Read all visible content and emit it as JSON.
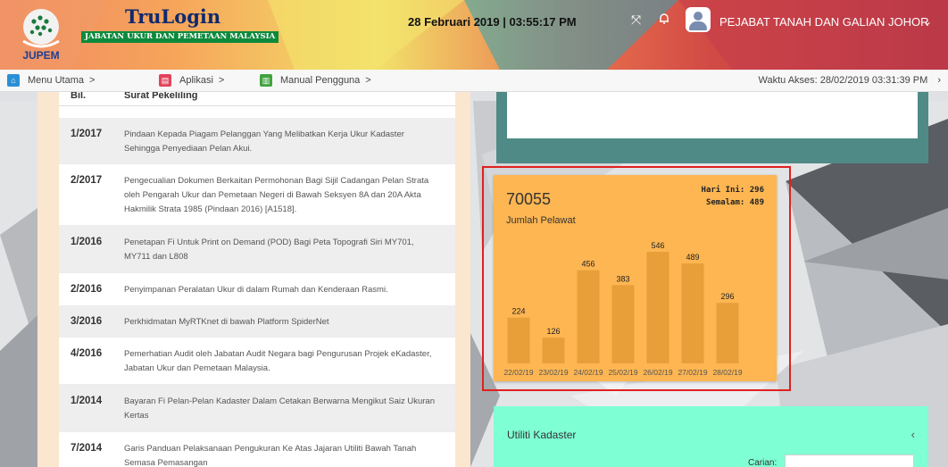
{
  "header": {
    "app_title": "TruLogin",
    "app_subtitle": "JABATAN UKUR DAN PEMETAAN MALAYSIA",
    "logo_text": "JUPEM",
    "datetime": "28 Februari 2019 | 03:55:17 PM",
    "office_name": "PEJABAT TANAH DAN GALIAN JOHOR",
    "icons": [
      "fullscreen-icon",
      "bell-icon",
      "user-avatar-icon",
      "chevron-down-icon"
    ]
  },
  "navbar": {
    "items": [
      {
        "label": "Menu Utama",
        "icon": "home-icon",
        "color": "#2a8fd6"
      },
      {
        "label": "Aplikasi",
        "icon": "app-icon",
        "color": "#e2445b"
      },
      {
        "label": "Manual Pengguna",
        "icon": "book-icon",
        "color": "#41a33d"
      }
    ],
    "separator": ">",
    "access_time": "Waktu Akses: 28/02/2019 03:31:39 PM"
  },
  "circulars": {
    "col_no": "Bil.",
    "col_title": "Surat Pekeliling",
    "rows": [
      {
        "no": "1/2017",
        "text": "Pindaan Kepada Piagam Pelanggan Yang Melibatkan Kerja Ukur Kadaster Sehingga Penyediaan Pelan Akui."
      },
      {
        "no": "2/2017",
        "text": "Pengecualian Dokumen Berkaitan Permohonan Bagi Sijil Cadangan Pelan Strata oleh Pengarah Ukur dan Pemetaan Negeri di Bawah Seksyen 8A dan 20A Akta Hakmilik Strata 1985 (Pindaan 2016) [A1518]."
      },
      {
        "no": "1/2016",
        "text": "Penetapan Fi Untuk Print on Demand (POD) Bagi Peta Topografi Siri MY701, MY711 dan L808"
      },
      {
        "no": "2/2016",
        "text": "Penyimpanan Peralatan Ukur di dalam Rumah dan Kenderaan Rasmi."
      },
      {
        "no": "3/2016",
        "text": "Perkhidmatan MyRTKnet di bawah Platform SpiderNet"
      },
      {
        "no": "4/2016",
        "text": "Pemerhatian Audit oleh Jabatan Audit Negara bagi Pengurusan Projek eKadaster, Jabatan Ukur dan Pemetaan Malaysia."
      },
      {
        "no": "1/2014",
        "text": "Bayaran Fi Pelan-Pelan Kadaster Dalam Cetakan Berwarna Mengikut Saiz Ukuran Kertas"
      },
      {
        "no": "7/2014",
        "text": "Garis Panduan Pelaksanaan Pengukuran Ke Atas Jajaran Utiliti Bawah Tanah Semasa Pemasangan"
      }
    ]
  },
  "visitors": {
    "total": "70055",
    "label": "Jumlah Pelawat",
    "today": "Hari Ini: 296",
    "yesterday": "Semalam: 489"
  },
  "chart_data": {
    "type": "bar",
    "categories": [
      "22/02/19",
      "23/02/19",
      "24/02/19",
      "25/02/19",
      "26/02/19",
      "27/02/19",
      "28/02/19"
    ],
    "values": [
      224,
      126,
      456,
      383,
      546,
      489,
      296
    ],
    "colors": {
      "bar": "#e89f3a",
      "card": "#fdb652"
    }
  },
  "utiliti": {
    "title": "Utiliti Kadaster",
    "search_label": "Carian:",
    "search_value": ""
  }
}
